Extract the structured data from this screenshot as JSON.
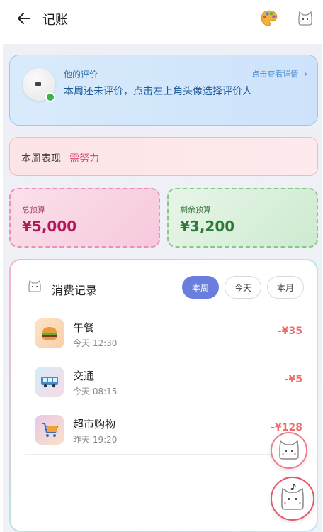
{
  "header": {
    "title": "记账"
  },
  "evaluation": {
    "label": "他的评价",
    "link": "点击查看详情 →",
    "text": "本周还未评价，点击左上角头像选择评价人"
  },
  "weekly": {
    "label": "本周表现",
    "value": "需努力"
  },
  "budget": {
    "total_label": "总预算",
    "total_value": "¥5,000",
    "remaining_label": "剩余预算",
    "remaining_value": "¥3,200"
  },
  "records": {
    "title": "消费记录",
    "filters": [
      "本周",
      "今天",
      "本月"
    ],
    "active_filter": "本周",
    "items": [
      {
        "name": "午餐",
        "time": "今天 12:30",
        "amount": "-¥35",
        "icon": "burger-icon"
      },
      {
        "name": "交通",
        "time": "今天 08:15",
        "amount": "-¥5",
        "icon": "bus-icon"
      },
      {
        "name": "超市购物",
        "time": "昨天 19:20",
        "amount": "-¥128",
        "icon": "shopping-cart-icon"
      }
    ]
  },
  "colors": {
    "accent": "#6a7fdd",
    "expense": "#f06c6c",
    "status_text": "#d64a7a"
  }
}
